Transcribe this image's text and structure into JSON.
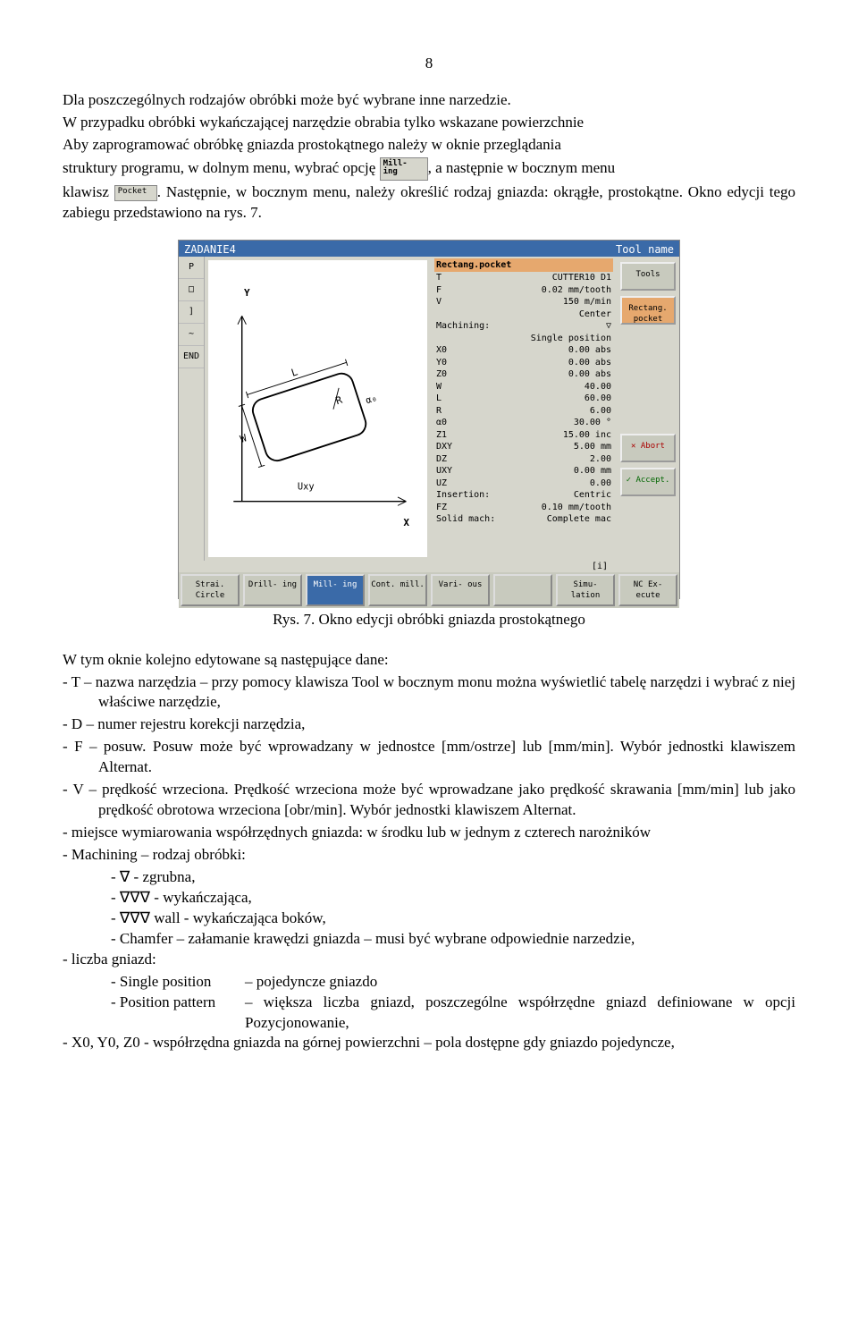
{
  "page_number": "8",
  "para1": "Dla poszczególnych rodzajów obróbki może być wybrane inne narzedzie.",
  "para2a": "W przypadku obróbki wykańczającej narzędzie obrabia tylko wskazane powierzchnie",
  "para2b": "Aby zaprogramować obróbkę gniazda prostokątnego należy w oknie przeglądania",
  "para2c": "struktury programu, w dolnym menu, wybrać opcję ",
  "para2d": ", a następnie w bocznym menu",
  "para2e": "klawisz ",
  "para2f": ". Następnie, w bocznym menu, należy określić rodzaj gniazda: okrągłe, prostokątne. Okno edycji tego zabiegu przedstawiono na rys. 7.",
  "inline_milling": "Mill-\ning",
  "inline_pocket": "Pocket",
  "screenshot": {
    "title": "ZADANIE4",
    "title_right": "Tool name",
    "leftcol": [
      "P",
      "□",
      "]",
      "~",
      "END"
    ],
    "diagram": {
      "y": "Y",
      "x": "X",
      "L": "L",
      "R": "R",
      "W": "W",
      "a0": "α₀",
      "U": "Uxy"
    },
    "params_hdr": "Rectang.pocket",
    "params": [
      [
        "T",
        "CUTTER10",
        "D1"
      ],
      [
        "F",
        "0.02 mm/tooth",
        ""
      ],
      [
        "V",
        "150 m/min",
        ""
      ],
      [
        "",
        "Center",
        ""
      ],
      [
        "Machining:",
        "▽",
        ""
      ],
      [
        "",
        "Single position",
        ""
      ],
      [
        "X0",
        "0.00 abs",
        ""
      ],
      [
        "Y0",
        "0.00 abs",
        ""
      ],
      [
        "Z0",
        "0.00 abs",
        ""
      ],
      [
        "W",
        "40.00",
        ""
      ],
      [
        "L",
        "60.00",
        ""
      ],
      [
        "R",
        "6.00",
        ""
      ],
      [
        "α0",
        "30.00 °",
        ""
      ],
      [
        "Z1",
        "15.00 inc",
        ""
      ],
      [
        "DXY",
        "5.00 mm",
        ""
      ],
      [
        "DZ",
        "2.00",
        ""
      ],
      [
        "UXY",
        "0.00 mm",
        ""
      ],
      [
        "UZ",
        "0.00",
        ""
      ],
      [
        "Insertion:",
        "Centric",
        ""
      ],
      [
        "FZ",
        "0.10 mm/tooth",
        ""
      ],
      [
        "Solid mach:",
        "Complete mac",
        ""
      ]
    ],
    "rightbtns": [
      "Tools",
      "Rectang. pocket",
      "",
      "",
      "",
      "✕ Abort",
      "✓ Accept."
    ],
    "info": "[i]",
    "footer": [
      "Strai. Circle",
      "Drill- ing",
      "Mill- ing",
      "Cont. mill.",
      "Vari- ous",
      "",
      "Simu- lation",
      "NC Ex- ecute"
    ]
  },
  "caption": "Rys. 7. Okno edycji obróbki gniazda prostokątnego",
  "intro": "W tym oknie kolejno edytowane są następujące dane:",
  "items": {
    "T": "- T – nazwa narzędzia – przy pomocy klawisza Tool w bocznym monu można wyświetlić tabelę narzędzi i wybrać z niej właściwe narzędzie,",
    "D": "- D – numer rejestru korekcji narzędzia,",
    "F": "- F – posuw. Posuw może być wprowadzany w jednostce [mm/ostrze] lub [mm/min]. Wybór jednostki klawiszem Alternat.",
    "V": "- V – prędkość wrzeciona. Prędkość wrzeciona może być wprowadzane jako prędkość skrawania [mm/min] lub jako prędkość obrotowa wrzeciona [obr/min]. Wybór jednostki klawiszem Alternat.",
    "miejsce": "- miejsce wymiarowania współrzędnych gniazda: w środku lub w jednym z czterech narożników",
    "mach_hdr": " - Machining – rodzaj obróbki:",
    "mach1": "- ∇         - zgrubna,",
    "mach2": "- ∇∇∇   - wykańczająca,",
    "mach3": "- ∇∇∇ wall    - wykańczająca boków,",
    "mach4": "- Chamfer – załamanie krawędzi gniazda – musi być wybrane odpowiednie narzedzie,",
    "liczba_hdr": "- liczba gniazd:",
    "pos1_l": "- Single position",
    "pos1_d": "– pojedyncze gniazdo",
    "pos2_l": "- Position pattern",
    "pos2_d": "– większa liczba gniazd, poszczególne współrzędne gniazd definiowane w opcji Pozycjonowanie,",
    "xyz": "- X0, Y0, Z0 - współrzędna gniazda na górnej powierzchni – pola dostępne gdy gniazdo pojedyncze,"
  }
}
